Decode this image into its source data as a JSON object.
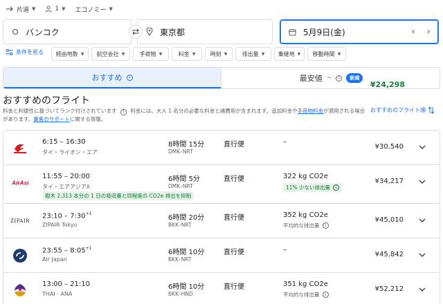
{
  "trip": {
    "trip_type": "片道",
    "passengers": "1",
    "cabin": "エコノミー"
  },
  "search": {
    "origin": "バンコク",
    "destination": "東京都",
    "date": "5月9日(金)"
  },
  "filters": {
    "all_filters_label": "条件を見る",
    "chips": [
      "経由地数",
      "航空会社",
      "手荷物",
      "料金",
      "時刻",
      "排出量",
      "乗継地",
      "移動時間"
    ]
  },
  "tabs": {
    "recommended": "おすすめ",
    "cheapest_label": "最安値",
    "cheapest_price": "¥24,298",
    "cheapest_suffix": "~",
    "new_badge": "新規"
  },
  "section": {
    "title": "おすすめのフライト",
    "desc_line1": "料金と利便性に基づいてランク付けされています",
    "desc_line1b": "料金には、大人 1 名分の必要な料金と諸費用が含まれます。追加料金や",
    "desc_link1": "手荷物料金",
    "desc_line1c": "が適用される場合",
    "desc_line2a": "があります。",
    "desc_link2": "乗客のサポート",
    "desc_line2b": "に関する情報。",
    "sort_label": "おすすめのフライト順"
  },
  "flights": [
    {
      "times": "6:15 – 16:30",
      "plus_day": "",
      "airline": "タイ・ライオン・エア",
      "duration": "8時間 15分",
      "route": "DMK–NRT",
      "stops": "直行便",
      "co2": "–",
      "co2_note": "",
      "price": "¥30,540",
      "logo_color": "#d71921"
    },
    {
      "times": "11:55 – 20:00",
      "plus_day": "",
      "airline": "タイ・エアアジアX",
      "duration": "6時間 5分",
      "route": "DMK–NRT",
      "stops": "直行便",
      "co2": "322 kg CO2e",
      "co2_note": "11% 少ない排出量",
      "eco_note": "樹木 2,313 本分の 1 日の吸収量と同程度の CO2e 排出を抑制",
      "price": "¥34,217",
      "logo_color": "#e4002b"
    },
    {
      "times": "23:10 – 7:30",
      "plus_day": "+1",
      "airline": "ZIPAIR Tokyo",
      "duration": "6時間 20分",
      "route": "BKK–NRT",
      "stops": "直行便",
      "co2": "352 kg CO2e",
      "co2_note": "平均的な排出量",
      "price": "¥45,010",
      "logo_text": "ZIPAIR"
    },
    {
      "times": "23:55 – 8:05",
      "plus_day": "+1",
      "airline": "Air Japan",
      "duration": "6時間 10分",
      "route": "BKK–NRT",
      "stops": "直行便",
      "co2": "–",
      "co2_note": "",
      "price": "¥45,842",
      "logo_color": "#1e3a6e"
    },
    {
      "times": "13:00 – 21:10",
      "plus_day": "",
      "airline": "THAI · ANA",
      "duration": "6時間 10分",
      "route": "BKK–HND",
      "stops": "直行便",
      "co2": "351 kg CO2e",
      "co2_note": "平均的な排出量",
      "price": "¥52,212",
      "logo_color": "#5b2a86"
    }
  ],
  "colors": {
    "accent": "#1a73e8",
    "green": "#188038",
    "border": "#dadce0"
  }
}
